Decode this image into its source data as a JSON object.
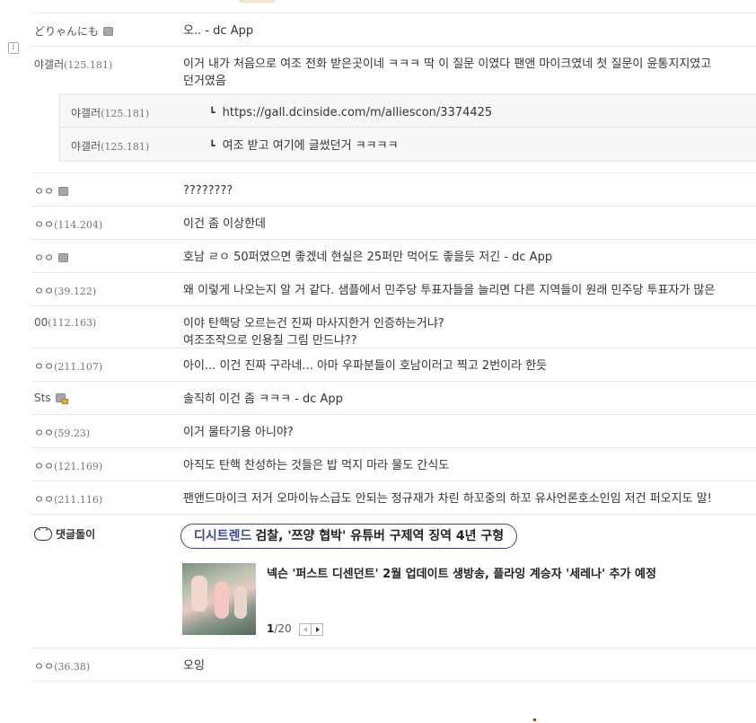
{
  "comments": [
    {
      "nick": "どりゃんにも",
      "ip": "",
      "badge": true,
      "memo": "오.. - dc App"
    },
    {
      "nick": "야갤러",
      "ip": "(125.181)",
      "memo_lines": [
        "이거 내가 처음으로 여조 전화 받은곳이네 ㅋㅋㅋ 딱 이 질문 이였다 팬앤 마이크였네 첫 질문이 윤통지지였고",
        "던거였음"
      ]
    },
    {
      "nick": "ㅇㅇ",
      "ip": "",
      "badge": true,
      "memo": "????????"
    },
    {
      "nick": "ㅇㅇ",
      "ip": "(114.204)",
      "memo": "이건 좀 이상한데"
    },
    {
      "nick": "ㅇㅇ",
      "ip": "",
      "badge": true,
      "memo": "호남 ㄹㅇ 50퍼였으면 좋겠네 현실은 25퍼만 먹어도 좋을듯 저긴 - dc App"
    },
    {
      "nick": "ㅇㅇ",
      "ip": "(39.122)",
      "memo": "왜 이렇게 나오는지 알 거 같다. 샘플에서 민주당 투표자들을 늘리면 다른 지역들이 원래 민주당 투표자가 많은"
    },
    {
      "nick": "00",
      "ip": "(112.163)",
      "memo_lines": [
        "이야 탄핵당 오르는건 진짜 마사지한거 인증하는거냐?",
        "여조조작으로 인용칠 그림 만드냐??"
      ]
    },
    {
      "nick": "ㅇㅇ",
      "ip": "(211.107)",
      "memo": "아이... 이건 진짜 구라네... 아마 우파분들이 호남이러고 찍고 2번이라 한듯"
    },
    {
      "nick": "Sts",
      "ip": "",
      "badge": true,
      "lock": true,
      "memo": "솔직히 이건 좀 ㅋㅋㅋ - dc App"
    },
    {
      "nick": "ㅇㅇ",
      "ip": "(59.23)",
      "memo": "이거 물타기용 아니야?"
    },
    {
      "nick": "ㅇㅇ",
      "ip": "(121.169)",
      "memo": "아직도 탄핵 찬성하는 것들은 밥 먹지 마라 물도 간식도"
    },
    {
      "nick": "ㅇㅇ",
      "ip": "(211.116)",
      "memo": "팬앤드마이크 저거 오마이뉴스급도 안되는 정규재가 차린 하꼬중의 하꼬 유사언론호소인임 저건 퍼오지도 말!"
    }
  ],
  "replies": [
    {
      "nick": "야갤러",
      "ip": "(125.181)",
      "memo": "https://gall.dcinside.com/m/alliescon/3374425"
    },
    {
      "nick": "야갤러",
      "ip": "(125.181)",
      "memo": "여조 받고 여기에 글썼던거 ㅋㅋㅋㅋ"
    }
  ],
  "reply_arrow": "┗",
  "bot": {
    "label": "댓글돌이",
    "icon": "bot-face-icon"
  },
  "trend": {
    "brand": "디시트렌드",
    "headline": "검찰, '쯔양 협박' 유튜버 구제역 징역 4년 구형"
  },
  "news": {
    "title": "넥슨 '퍼스트 디센던트' 2월 업데이트 생방송, 플라잉 계승자 '세레나' 추가 예정",
    "page_current": "1",
    "page_total": "/20"
  },
  "last_comment": {
    "nick": "ㅇㅇ",
    "ip": "(36.38)",
    "memo": "오잉"
  },
  "colors": {
    "accent": "#3b4890",
    "border": "#e8e8e8",
    "reply_bg": "#f7f7f7"
  }
}
